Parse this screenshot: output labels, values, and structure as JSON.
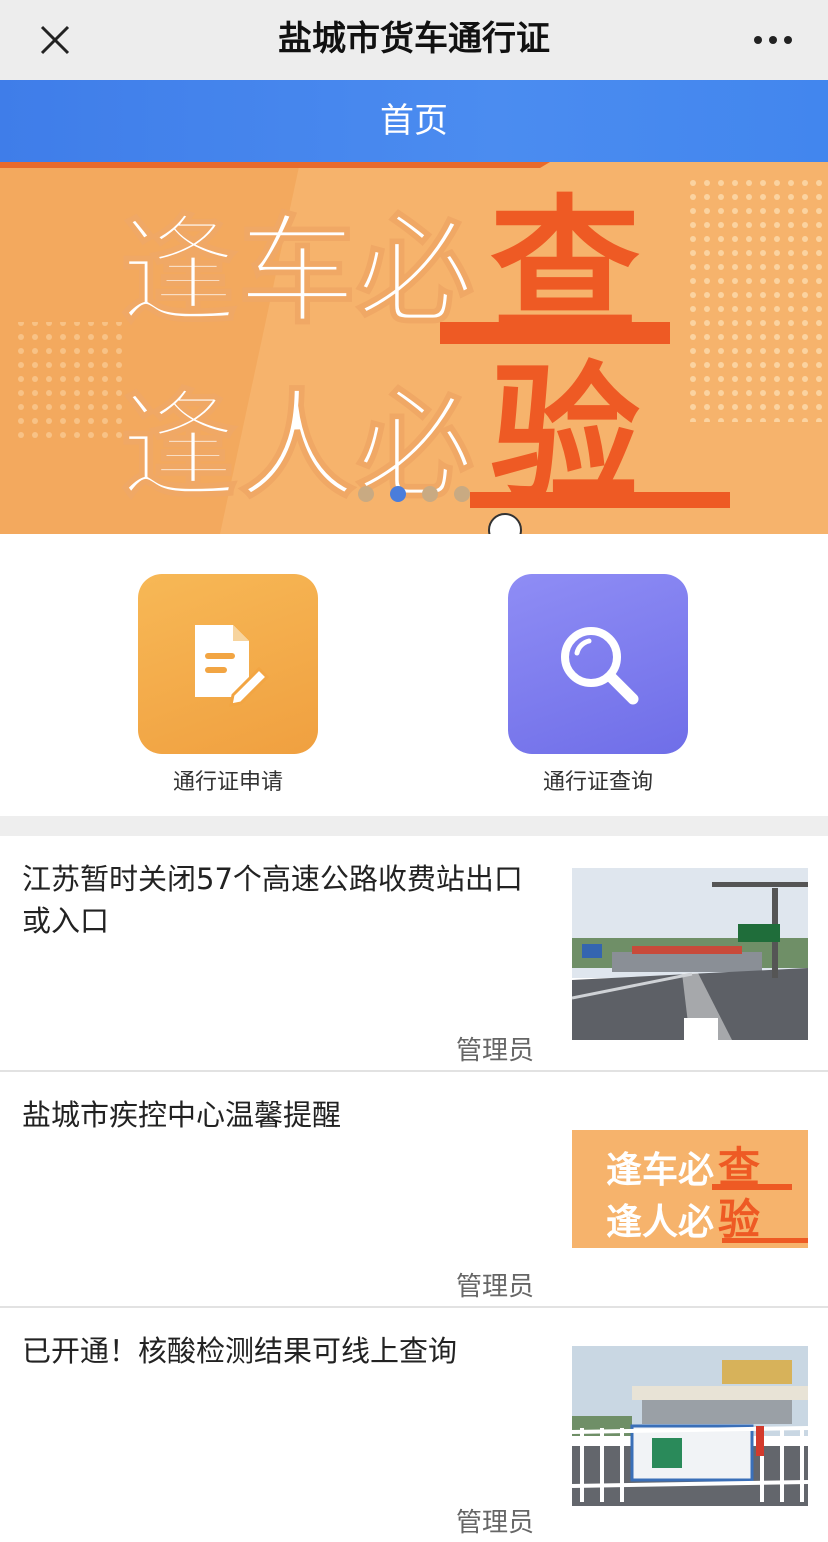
{
  "header": {
    "title": "盐城市货车通行证",
    "close_icon": "close-icon",
    "more_icon": "more-dots-icon"
  },
  "nav": {
    "title": "首页"
  },
  "banner": {
    "line1_white": "逢车必",
    "line1_red": "查",
    "line2_white": "逢人必",
    "line2_red": "验",
    "slide_count": 4,
    "active_slide": 2
  },
  "quick_actions": [
    {
      "label": "通行证申请",
      "icon": "document-edit-icon",
      "color": "#f3a646"
    },
    {
      "label": "通行证查询",
      "icon": "search-icon",
      "color": "#7f78ef"
    }
  ],
  "news": [
    {
      "title": "江苏暂时关闭57个高速公路收费站出口或入口",
      "author": "管理员",
      "thumb": "highway-photo"
    },
    {
      "title": "盐城市疾控中心温馨提醒",
      "author": "管理员",
      "thumb": "slogan-banner",
      "thumb_text1": "逢车必",
      "thumb_text2": "查",
      "thumb_text3": "逢人必",
      "thumb_text4": "验"
    },
    {
      "title": "已开通！核酸检测结果可线上查询",
      "author": "管理员",
      "thumb": "toll-station-photo"
    }
  ],
  "colors": {
    "nav_blue": "#4286ee",
    "banner_orange": "#f6b36c",
    "banner_red": "#ee5a24",
    "dot_active": "#4a7ddb"
  }
}
